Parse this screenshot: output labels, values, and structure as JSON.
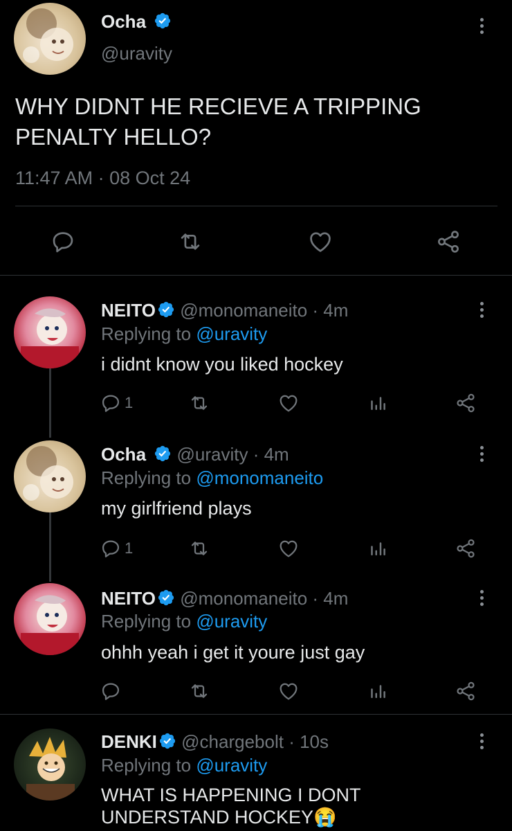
{
  "main_tweet": {
    "name": "Ocha",
    "handle": "@uravity",
    "text_line1": "WHY DIDNT HE RECIEVE A TRIPPING",
    "text_line2": "PENALTY HELLO?",
    "time": "11:47 AM",
    "separator": "·",
    "date": "08 Oct 24"
  },
  "replies": [
    {
      "name": "NEITO",
      "handle": "@monomaneito",
      "time": "· 4m",
      "replying_prefix": "Replying to",
      "replying_to": "@uravity",
      "text": "i didnt know you liked hockey",
      "reply_count": "1"
    },
    {
      "name": "Ocha",
      "handle": "@uravity",
      "time": "· 4m",
      "replying_prefix": "Replying to",
      "replying_to": "@monomaneito",
      "text": "my girlfriend plays",
      "reply_count": "1"
    },
    {
      "name": "NEITO",
      "handle": "@monomaneito",
      "time": "· 4m",
      "replying_prefix": "Replying to",
      "replying_to": "@uravity",
      "text": "ohhh yeah i get it youre just gay",
      "reply_count": ""
    },
    {
      "name": "DENKI",
      "handle": "@chargebolt",
      "time": "· 10s",
      "replying_prefix": "Replying to",
      "replying_to": "@uravity",
      "text_line1": "WHAT IS HAPPENING I DONT",
      "text_line2": "UNDERSTAND HOCKEY",
      "emoji": "😭"
    }
  ],
  "colors": {
    "background": "#000000",
    "text": "#e7e9ea",
    "muted": "#71767b",
    "link": "#1d9bf0",
    "verified": "#1d9bf0",
    "divider": "#2f3336"
  }
}
